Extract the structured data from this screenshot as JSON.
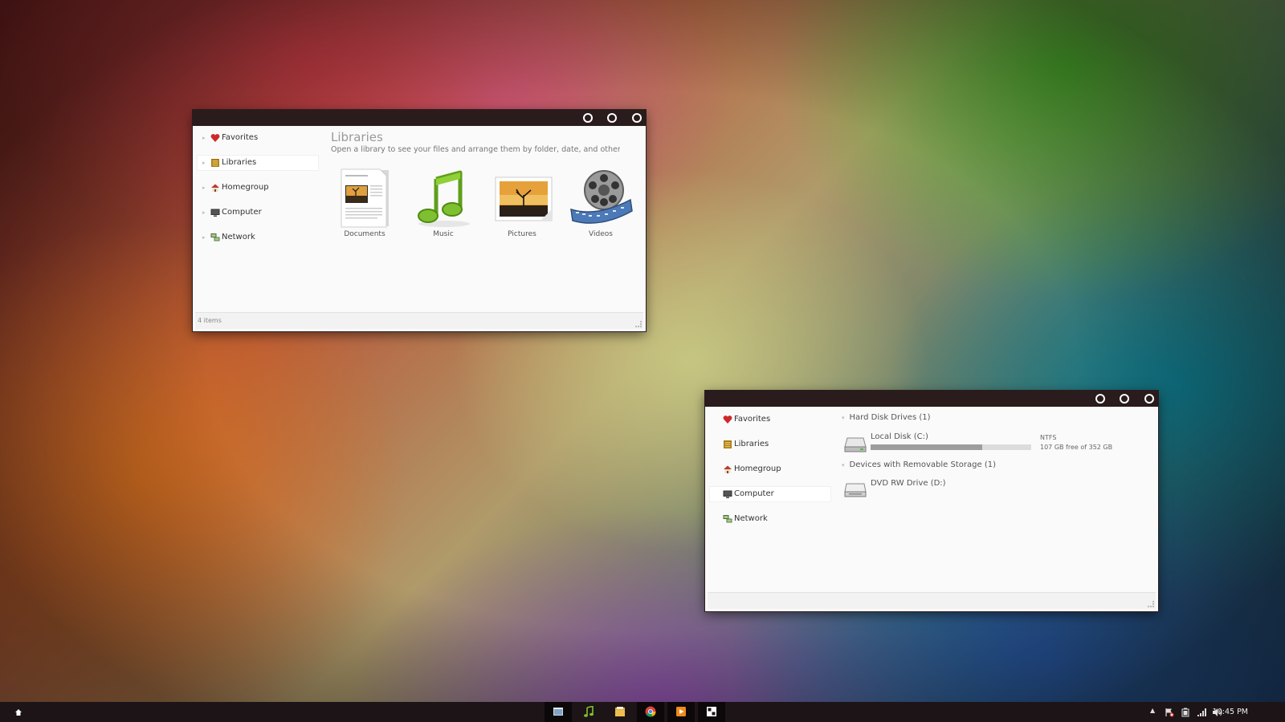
{
  "libraries_window": {
    "nav_items": [
      {
        "label": "Favorites"
      },
      {
        "label": "Libraries"
      },
      {
        "label": "Homegroup"
      },
      {
        "label": "Computer"
      },
      {
        "label": "Network"
      }
    ],
    "title": "Libraries",
    "description": "Open a library to see your files and arrange them by folder, date, and other prope...",
    "items": [
      {
        "label": "Documents",
        "icon": "documents-icon"
      },
      {
        "label": "Music",
        "icon": "music-icon"
      },
      {
        "label": "Pictures",
        "icon": "pictures-icon"
      },
      {
        "label": "Videos",
        "icon": "videos-icon"
      }
    ],
    "status": "4 items"
  },
  "computer_window": {
    "nav_items": [
      {
        "label": "Favorites"
      },
      {
        "label": "Libraries"
      },
      {
        "label": "Homegroup"
      },
      {
        "label": "Computer"
      },
      {
        "label": "Network"
      }
    ],
    "hdd_section": "Hard Disk Drives (1)",
    "local_disk": {
      "name": "Local Disk (C:)",
      "filesystem": "NTFS",
      "free_text": "107 GB free of 352 GB",
      "used_fraction": 0.696
    },
    "removable_section": "Devices with Removable Storage (1)",
    "dvd_drive": {
      "name": "DVD RW Drive (D:)"
    }
  },
  "taskbar": {
    "apps": [
      "explorer-icon",
      "music-player-icon",
      "folder-icon",
      "chrome-icon",
      "media-player-icon",
      "screen-icon"
    ],
    "clock": "10:45 PM"
  },
  "colors": {
    "titlebar": "#2a1c1c",
    "taskbar": "#1c1416",
    "accent_red": "#cc2a2a"
  }
}
